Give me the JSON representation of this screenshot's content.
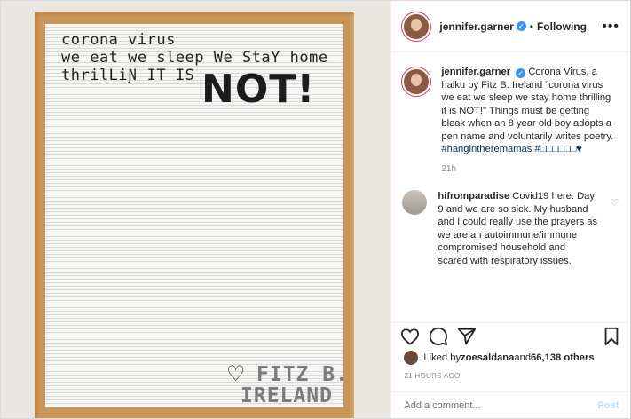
{
  "board": {
    "line1": "corona virus",
    "line2": "we eat we  sleep We StaY home",
    "line3": "thrilLiƝ  IT IS",
    "big": "NOT!",
    "heart": "♡",
    "sig1": "FITZ B.",
    "sig2": "IRELAND"
  },
  "header": {
    "username": "jennifer.garner",
    "verified_icon": "✓",
    "separator": "•",
    "following": "Following",
    "more": "•••"
  },
  "caption": {
    "username": "jennifer.garner",
    "verified_icon": "✓",
    "text": " Corona Virus, a haiku by Fitz B. Ireland \"corona virus we eat we sleep we stay home thrilling it is NOT!\" Things must be getting bleak when an 8 year old boy adopts a pen name and voluntarily writes poetry. ",
    "hashtag": "#hangintheremamas #□□□□□□♥",
    "time": "21h"
  },
  "comment": {
    "username": "hifromparadise",
    "text": " Covid19 here. Day 9 and we are so sick. My husband and I could really use the prayers as we are an autoimmune/immune compromised household and scared with respiratory issues.",
    "heart_icon": "♡"
  },
  "likes": {
    "prefix": "Liked by ",
    "user": "zoesaldana",
    "middle": " and ",
    "count": "66,138 others"
  },
  "posted": "21 HOURS AGO",
  "add_comment": {
    "placeholder": "Add a comment...",
    "post_label": "Post"
  }
}
